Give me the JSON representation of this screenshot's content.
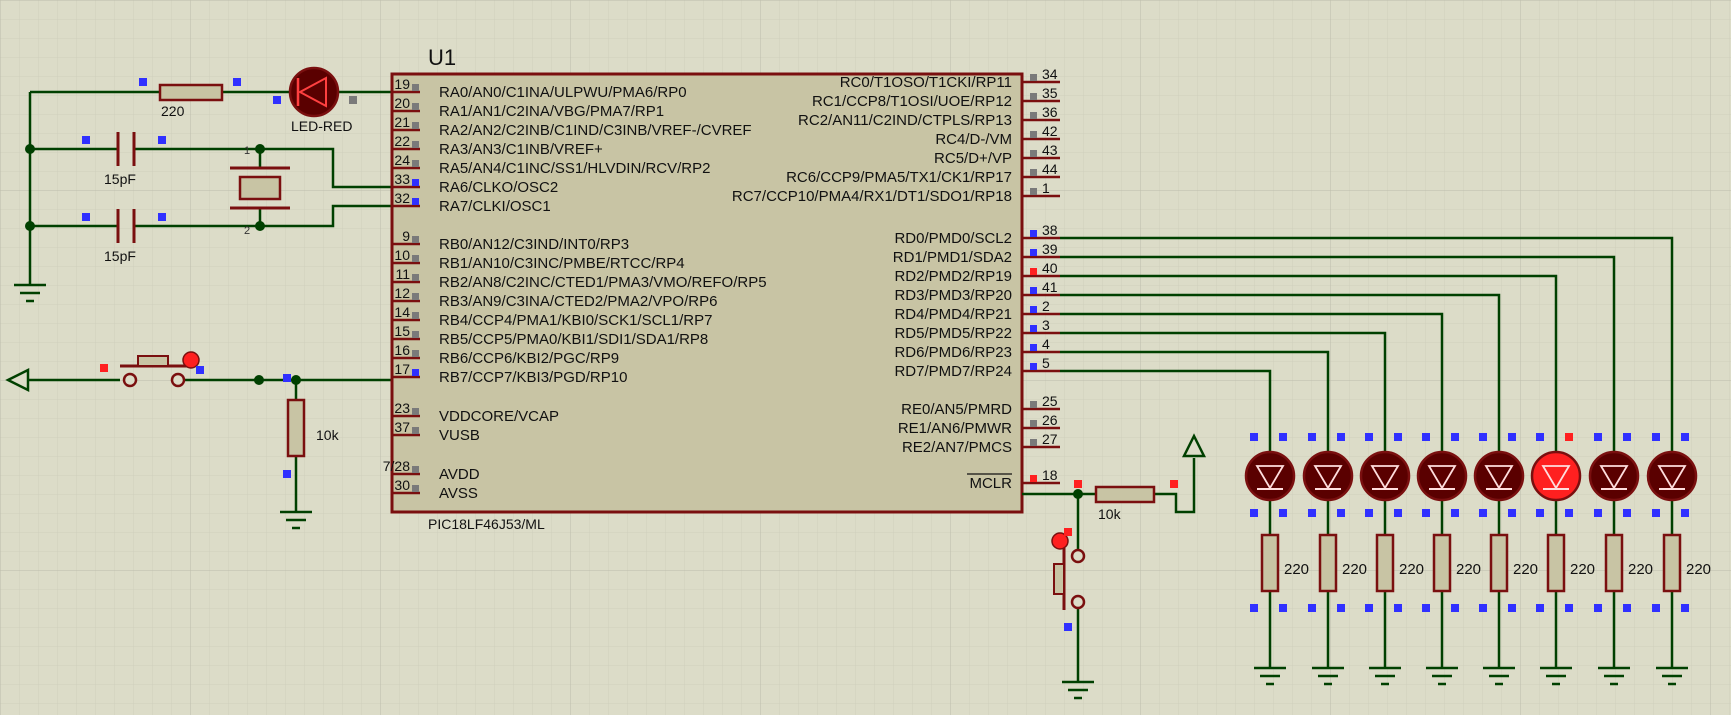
{
  "colors": {
    "background": "#dcdcc8",
    "grid_minor": "#cfcfbd",
    "grid_major": "#bdbdab",
    "wire": "#004000",
    "component": "#7a0f0f",
    "chip_fill": "#c8c4a4",
    "pin_marker_blue": "#3030ff",
    "pin_marker_red": "#ff2020",
    "pin_marker_gray": "#7a7a7a",
    "led_off": "#5a0000",
    "led_on": "#ff2020",
    "text": "#111111"
  },
  "chip": {
    "ref": "U1",
    "part": "PIC18LF46J53/ML",
    "left_pins": [
      {
        "num": "19",
        "label": "RA0/AN0/C1INA/ULPWU/PMA6/RP0"
      },
      {
        "num": "20",
        "label": "RA1/AN1/C2INA/VBG/PMA7/RP1"
      },
      {
        "num": "21",
        "label": "RA2/AN2/C2INB/C1IND/C3INB/VREF-/CVREF"
      },
      {
        "num": "22",
        "label": "RA3/AN3/C1INB/VREF+"
      },
      {
        "num": "24",
        "label": "RA5/AN4/C1INC/SS1/HLVDIN/RCV/RP2"
      },
      {
        "num": "33",
        "label": "RA6/CLKO/OSC2"
      },
      {
        "num": "32",
        "label": "RA7/CLKI/OSC1"
      },
      {
        "num": "9",
        "label": "RB0/AN12/C3IND/INT0/RP3"
      },
      {
        "num": "10",
        "label": "RB1/AN10/C3INC/PMBE/RTCC/RP4"
      },
      {
        "num": "11",
        "label": "RB2/AN8/C2INC/CTED1/PMA3/VMO/REFO/RP5"
      },
      {
        "num": "12",
        "label": "RB3/AN9/C3INA/CTED2/PMA2/VPO/RP6"
      },
      {
        "num": "14",
        "label": "RB4/CCP4/PMA1/KBI0/SCK1/SCL1/RP7"
      },
      {
        "num": "15",
        "label": "RB5/CCP5/PMA0/KBI1/SDI1/SDA1/RP8"
      },
      {
        "num": "16",
        "label": "RB6/CCP6/KBI2/PGC/RP9"
      },
      {
        "num": "17",
        "label": "RB7/CCP7/KBI3/PGD/RP10"
      },
      {
        "num": "23",
        "label": "VDDCORE/VCAP"
      },
      {
        "num": "37",
        "label": "VUSB"
      },
      {
        "num": "7/28",
        "label": "AVDD"
      },
      {
        "num": "30",
        "label": "AVSS"
      }
    ],
    "right_pins": [
      {
        "num": "34",
        "label": "RC0/T1OSO/T1CKI/RP11"
      },
      {
        "num": "35",
        "label": "RC1/CCP8/T1OSI/UOE/RP12"
      },
      {
        "num": "36",
        "label": "RC2/AN11/C2IND/CTPLS/RP13"
      },
      {
        "num": "42",
        "label": "RC4/D-/VM"
      },
      {
        "num": "43",
        "label": "RC5/D+/VP"
      },
      {
        "num": "44",
        "label": "RC6/CCP9/PMA5/TX1/CK1/RP17"
      },
      {
        "num": "1",
        "label": "RC7/CCP10/PMA4/RX1/DT1/SDO1/RP18"
      },
      {
        "num": "38",
        "label": "RD0/PMD0/SCL2"
      },
      {
        "num": "39",
        "label": "RD1/PMD1/SDA2"
      },
      {
        "num": "40",
        "label": "RD2/PMD2/RP19"
      },
      {
        "num": "41",
        "label": "RD3/PMD3/RP20"
      },
      {
        "num": "2",
        "label": "RD4/PMD4/RP21"
      },
      {
        "num": "3",
        "label": "RD5/PMD5/RP22"
      },
      {
        "num": "4",
        "label": "RD6/PMD6/RP23"
      },
      {
        "num": "5",
        "label": "RD7/PMD7/RP24"
      },
      {
        "num": "25",
        "label": "RE0/AN5/PMRD"
      },
      {
        "num": "26",
        "label": "RE1/AN6/PMWR"
      },
      {
        "num": "27",
        "label": "RE2/AN7/PMCS"
      },
      {
        "num": "18",
        "label": "MCLR"
      }
    ]
  },
  "components": {
    "r_led": "220",
    "led_label": "LED-RED",
    "c1": "15pF",
    "c2": "15pF",
    "r_pulldown": "10k",
    "r_mclr": "10k",
    "out_leds": [
      {
        "value": "220",
        "lit": false
      },
      {
        "value": "220",
        "lit": false
      },
      {
        "value": "220",
        "lit": false
      },
      {
        "value": "220",
        "lit": false
      },
      {
        "value": "220",
        "lit": false
      },
      {
        "value": "220",
        "lit": true
      },
      {
        "value": "220",
        "lit": false
      },
      {
        "value": "220",
        "lit": false
      }
    ]
  }
}
